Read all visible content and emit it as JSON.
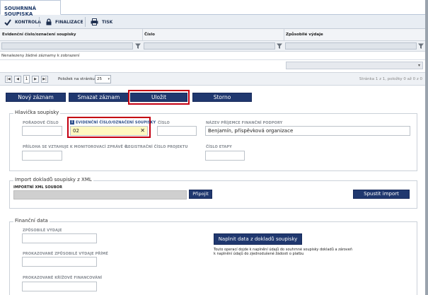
{
  "tab": {
    "title": "SOUHRNNÁ SOUPISKA"
  },
  "toolbar": {
    "kontrola": "KONTROLA",
    "finalizace": "FINALIZACE",
    "tisk": "TISK"
  },
  "grid": {
    "columns": [
      "Evidenční číslo/označení soupisky",
      "Číslo",
      "Způsobilé výdaje"
    ],
    "empty_message": "Nenalezeny žádné záznamy k zobrazení"
  },
  "pager": {
    "current_page": "1",
    "items_per_page_label": "Položek na stránku",
    "items_per_page": "25",
    "info": "Stránka 1 z 1, položky 0 až 0 z 0"
  },
  "actions": {
    "new": "Nový záznam",
    "delete": "Smazat záznam",
    "save": "Uložit",
    "cancel": "Storno"
  },
  "header_panel": {
    "title": "Hlavička soupisky",
    "poradove_cislo_label": "POŘADOVÉ ČÍSLO",
    "poradove_cislo_value": "",
    "evidencni_label": "EVIDENČNÍ ČÍSLO/OZNAČENÍ SOUPISKY",
    "evidencni_value": "02",
    "cislo_label": "ČÍSLO",
    "cislo_value": "",
    "prijemce_label": "NÁZEV PŘÍJEMCE FINANČNÍ PODPORY",
    "prijemce_value": "Benjamín, příspěvková organizace",
    "priloha_label": "PŘÍLOHA SE VZTAHUJE K MONITOROVACÍ ZPRÁVĚ Č.",
    "registracni_label": "REGISTRAČNÍ ČÍSLO PROJEKTU",
    "etapa_label": "ČÍSLO ETAPY"
  },
  "import_panel": {
    "title": "Import dokladů soupisky z XML",
    "file_label": "IMPORTNÍ XML SOUBOR",
    "attach": "Připojit",
    "run_import": "Spustit import"
  },
  "finance_panel": {
    "title": "Finanční data",
    "zpusobile_label": "ZPŮSOBILÉ VÝDAJE",
    "prokazane_label": "PROKAZOVANÉ ZPŮSOBILÉ VÝDAJE PŘÍMÉ",
    "krizove_label": "PROKAZOVANÉ KŘÍŽOVÉ FINANCOVÁNÍ",
    "fill_button": "Naplnit data z dokladů soupisky",
    "note_line1": "Touto operací dojde k naplnění údajů do souhrnné soupisky dokladů a zároveň",
    "note_line2": "k naplnění údajů do zjednodušené žádosti o platbu"
  },
  "colors": {
    "button_blue": "#20386f",
    "highlight_red": "#c40012",
    "focused_field": "#fff8c0"
  }
}
